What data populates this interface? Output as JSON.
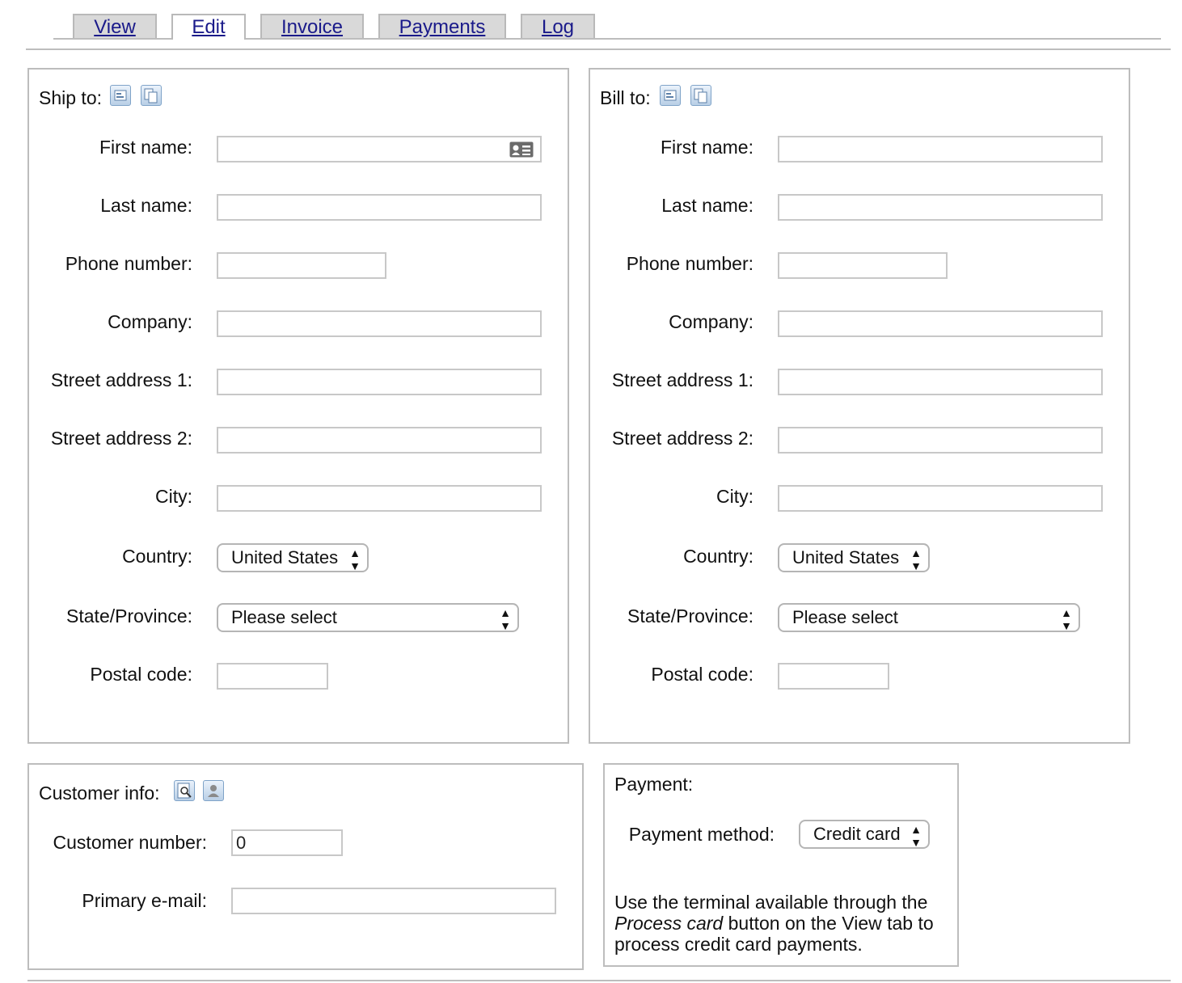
{
  "tabs": [
    {
      "label": "View"
    },
    {
      "label": "Edit"
    },
    {
      "label": "Invoice"
    },
    {
      "label": "Payments"
    },
    {
      "label": "Log"
    }
  ],
  "active_tab": "Edit",
  "ship_to": {
    "title": "Ship to:",
    "fields": {
      "first_name": {
        "label": "First name:",
        "value": ""
      },
      "last_name": {
        "label": "Last name:",
        "value": ""
      },
      "phone": {
        "label": "Phone number:",
        "value": ""
      },
      "company": {
        "label": "Company:",
        "value": ""
      },
      "street1": {
        "label": "Street address 1:",
        "value": ""
      },
      "street2": {
        "label": "Street address 2:",
        "value": ""
      },
      "city": {
        "label": "City:",
        "value": ""
      },
      "country": {
        "label": "Country:",
        "value": "United States"
      },
      "state": {
        "label": "State/Province:",
        "value": "Please select"
      },
      "postal": {
        "label": "Postal code:",
        "value": ""
      }
    }
  },
  "bill_to": {
    "title": "Bill to:",
    "fields": {
      "first_name": {
        "label": "First name:",
        "value": ""
      },
      "last_name": {
        "label": "Last name:",
        "value": ""
      },
      "phone": {
        "label": "Phone number:",
        "value": ""
      },
      "company": {
        "label": "Company:",
        "value": ""
      },
      "street1": {
        "label": "Street address 1:",
        "value": ""
      },
      "street2": {
        "label": "Street address 2:",
        "value": ""
      },
      "city": {
        "label": "City:",
        "value": ""
      },
      "country": {
        "label": "Country:",
        "value": "United States"
      },
      "state": {
        "label": "State/Province:",
        "value": "Please select"
      },
      "postal": {
        "label": "Postal code:",
        "value": ""
      }
    }
  },
  "customer_info": {
    "title": "Customer info:",
    "customer_number": {
      "label": "Customer number:",
      "value": "0"
    },
    "primary_email": {
      "label": "Primary e-mail:",
      "value": ""
    }
  },
  "payment": {
    "title": "Payment:",
    "method_label": "Payment method:",
    "method_value": "Credit card",
    "note_part1": "Use the terminal available through the",
    "note_em": "Process card",
    "note_part2": "button on the View tab to process credit card payments."
  },
  "icons": {
    "address_book": "address-book-icon",
    "copy": "copy-icon",
    "search": "search-icon",
    "user": "user-icon",
    "contact_card": "contact-card-icon"
  }
}
